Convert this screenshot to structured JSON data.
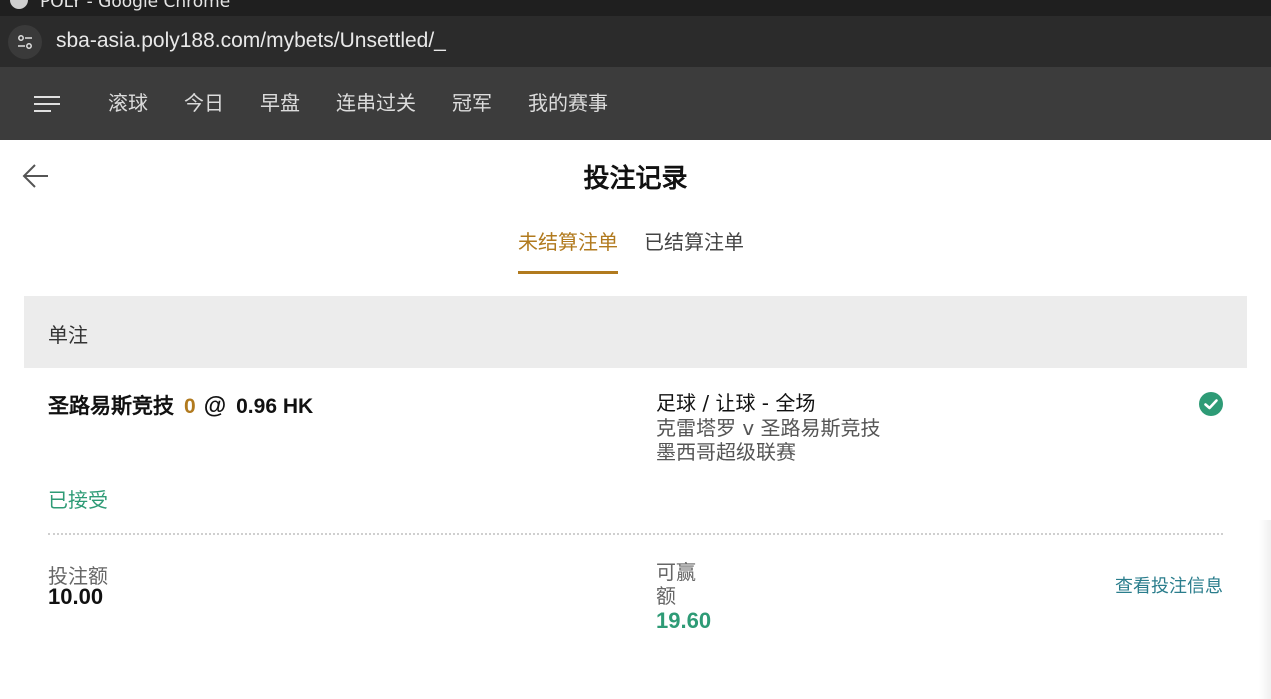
{
  "window": {
    "title": "POLY - Google Chrome"
  },
  "browser": {
    "url": "sba-asia.poly188.com/mybets/Unsettled/_"
  },
  "nav": {
    "items": [
      {
        "label": "滚球"
      },
      {
        "label": "今日"
      },
      {
        "label": "早盘"
      },
      {
        "label": "连串过关"
      },
      {
        "label": "冠军"
      },
      {
        "label": "我的赛事"
      }
    ]
  },
  "page": {
    "title": "投注记录",
    "tabs": [
      {
        "label": "未结算注单",
        "active": true
      },
      {
        "label": "已结算注单",
        "active": false
      }
    ]
  },
  "section": {
    "title": "单注"
  },
  "bet": {
    "selection": "圣路易斯竞技",
    "handicap": "0",
    "at": "@",
    "odds": "0.96 HK",
    "market": "足球 / 让球 - 全场",
    "teams": "克雷塔罗 v 圣路易斯竞技",
    "league": "墨西哥超级联赛",
    "status": "已接受",
    "stake_label": "投注额",
    "stake": "10.00",
    "win_label": "可赢额",
    "win": "19.60",
    "view_link": "查看投注信息"
  },
  "colors": {
    "accent": "#b17a1e",
    "success": "#2e9b76",
    "nav_bg": "#3c3c3c",
    "link": "#2a7d8c"
  },
  "icons": {
    "menu": "hamburger-icon",
    "back": "arrow-left-icon",
    "status": "check-circle-icon",
    "site_info": "tune-icon"
  }
}
